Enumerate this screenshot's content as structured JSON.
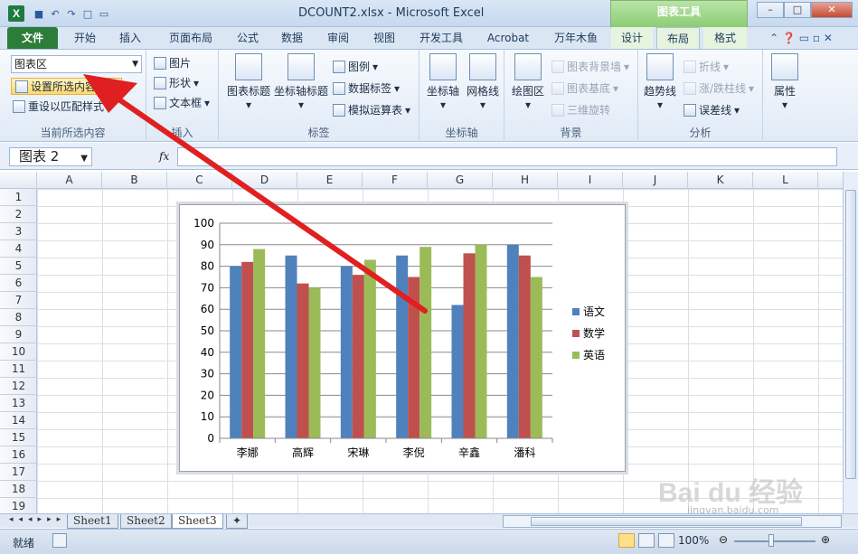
{
  "window": {
    "title": "DCOUNT2.xlsx  -  Microsoft Excel",
    "app_icon": "X",
    "context_tools": "图表工具"
  },
  "qat": {
    "undo": "↶",
    "redo": "↷",
    "save": "■",
    "new": "□",
    "open": "▭"
  },
  "tabs": [
    {
      "label": "文件"
    },
    {
      "label": "开始"
    },
    {
      "label": "插入"
    },
    {
      "label": "页面布局"
    },
    {
      "label": "公式"
    },
    {
      "label": "数据"
    },
    {
      "label": "审阅"
    },
    {
      "label": "视图"
    },
    {
      "label": "开发工具"
    },
    {
      "label": "Acrobat"
    },
    {
      "label": "万年木鱼"
    },
    {
      "label": "设计"
    },
    {
      "label": "布局"
    },
    {
      "label": "格式"
    }
  ],
  "ribbon": {
    "current_selection": {
      "combo_value": "图表区",
      "format_selection": "设置所选内容格式",
      "reset_style": "重设以匹配样式",
      "label": "当前所选内容"
    },
    "insert": {
      "picture": "图片",
      "shapes": "形状",
      "textbox": "文本框",
      "label": "插入"
    },
    "labels": {
      "chart_title": "图表标题",
      "axis_title": "坐标轴标题",
      "legend": "图例",
      "data_labels": "数据标签",
      "data_table": "模拟运算表",
      "label": "标签"
    },
    "axes": {
      "axes": "坐标轴",
      "gridlines": "网格线",
      "label": "坐标轴"
    },
    "background": {
      "plot_area": "绘图区",
      "chart_wall": "图表背景墙",
      "chart_floor": "图表基底",
      "rotation": "三维旋转",
      "label": "背景"
    },
    "analysis": {
      "trendline": "趋势线",
      "lines": "折线",
      "updown_bars": "涨/跌柱线",
      "error_bars": "误差线",
      "label": "分析"
    },
    "properties": {
      "label": "属性"
    }
  },
  "formula_bar": {
    "name_box": "图表 2",
    "fx": "fx",
    "value": ""
  },
  "columns": [
    "A",
    "B",
    "C",
    "D",
    "E",
    "F",
    "G",
    "H",
    "I",
    "J",
    "K",
    "L"
  ],
  "rows": [
    "1",
    "2",
    "3",
    "4",
    "5",
    "6",
    "7",
    "8",
    "9",
    "10",
    "11",
    "12",
    "13",
    "14",
    "15",
    "16",
    "17",
    "18",
    "19"
  ],
  "chart_data": {
    "type": "bar",
    "categories": [
      "李娜",
      "高辉",
      "宋琳",
      "李倪",
      "辛鑫",
      "潘科"
    ],
    "series": [
      {
        "name": "语文",
        "values": [
          80,
          85,
          80,
          85,
          62,
          90
        ],
        "color": "#4f81bd"
      },
      {
        "name": "数学",
        "values": [
          82,
          72,
          76,
          75,
          86,
          85
        ],
        "color": "#c0504d"
      },
      {
        "name": "英语",
        "values": [
          88,
          70,
          83,
          89,
          90,
          75
        ],
        "color": "#9bbb59"
      }
    ],
    "ylim": [
      0,
      100
    ],
    "yticks": [
      "0",
      "10",
      "20",
      "30",
      "40",
      "50",
      "60",
      "70",
      "80",
      "90",
      "100"
    ],
    "grid": true,
    "legend": "right"
  },
  "sheets": [
    {
      "name": "Sheet1"
    },
    {
      "name": "Sheet2"
    },
    {
      "name": "Sheet3"
    }
  ],
  "status": {
    "ready": "就绪",
    "zoom": "100%"
  },
  "watermark": {
    "brand": "Bai du 经验",
    "url": "jingyan.baidu.com"
  },
  "annotation": {
    "arrow_color": "#e02020"
  }
}
